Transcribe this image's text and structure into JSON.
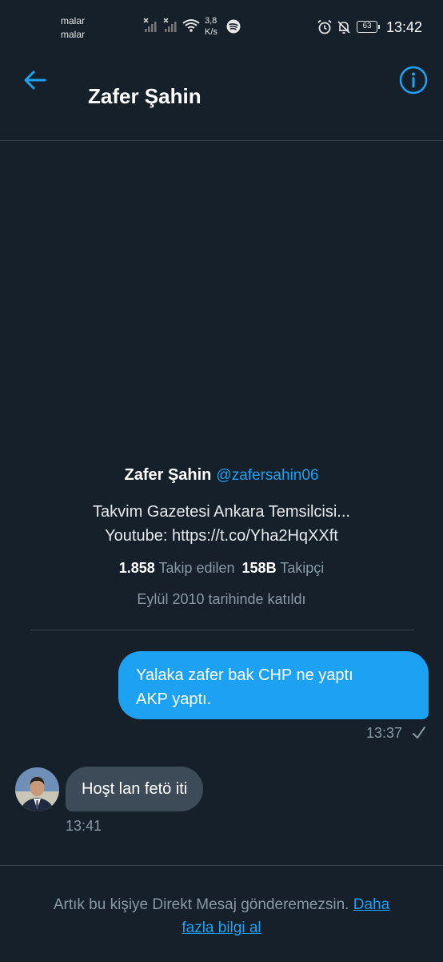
{
  "status_bar": {
    "carrier_line1": "malar",
    "carrier_line2": "malar",
    "speed_value": "3,8",
    "speed_unit": "K/s",
    "battery": "63",
    "time": "13:42"
  },
  "header": {
    "title": "Zafer Şahin"
  },
  "profile": {
    "name": "Zafer Şahin",
    "handle": "@zafersahin06",
    "bio_line1": "Takvim Gazetesi Ankara Temsilcisi...",
    "bio_line2": "Youtube: https://t.co/Yha2HqXXft",
    "following_count": "1.858",
    "following_label": "Takip edilen",
    "followers_count": "158B",
    "followers_label": "Takipçi",
    "joined": "Eylül 2010 tarihinde katıldı"
  },
  "messages": [
    {
      "direction": "outgoing",
      "line1": "Yalaka zafer bak CHP ne yaptı",
      "line2": "AKP yaptı.",
      "time": "13:37"
    },
    {
      "direction": "incoming",
      "text": "Hoşt lan fetö iti",
      "time": "13:41"
    }
  ],
  "footer": {
    "notice": "Artık bu kişiye Direkt Mesaj gönderemezsin.",
    "link_part1": "Daha",
    "link_part2": "fazla bilgi al"
  },
  "colors": {
    "background": "#15202b",
    "accent": "#1da1f2",
    "incoming_bubble": "#3d4b58",
    "muted_text": "#8899a6"
  }
}
